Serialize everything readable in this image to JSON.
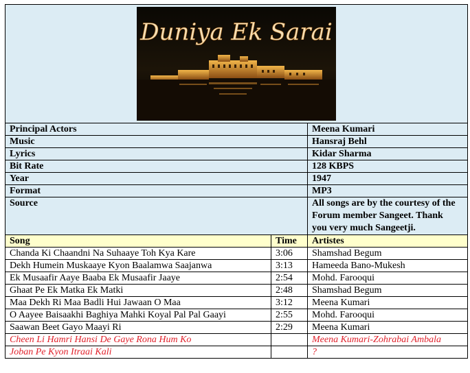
{
  "banner": {
    "title": "Duniya Ek Sarai"
  },
  "info": [
    {
      "label": "Principal Actors",
      "value": "Meena Kumari"
    },
    {
      "label": "Music",
      "value": "Hansraj Behl"
    },
    {
      "label": "Lyrics",
      "value": "Kidar Sharma"
    },
    {
      "label": "Bit Rate",
      "value": "128 KBPS"
    },
    {
      "label": "Year",
      "value": "1947"
    },
    {
      "label": "Format",
      "value": "MP3"
    },
    {
      "label": "Source",
      "value": "All songs are by the courtesy of the Forum member Sangeet.  Thank you very much Sangeetji."
    }
  ],
  "songs_header": {
    "song": "Song",
    "time": "Time",
    "artists": "Artistes"
  },
  "songs": [
    {
      "song": "Chanda Ki Chaandni Na Suhaaye Toh Kya Kare",
      "time": "3:06",
      "artists": "Shamshad Begum"
    },
    {
      "song": "Dekh Humein Muskaaye Kyon Baalamwa Saajanwa",
      "time": "3:13",
      "artists": "Hameeda Bano-Mukesh"
    },
    {
      "song": "Ek Musaafir Aaye Baaba Ek Musaafir Jaaye",
      "time": "2:54",
      "artists": "Mohd. Farooqui"
    },
    {
      "song": "Ghaat Pe Ek Matka Ek Matki",
      "time": "2:48",
      "artists": "Shamshad Begum"
    },
    {
      "song": "Maa Dekh Ri Maa Badli Hui Jawaan O Maa",
      "time": "3:12",
      "artists": "Meena Kumari"
    },
    {
      "song": "O Aayee Baisaakhi  Baghiya Mahki Koyal Pal Pal Gaayi",
      "time": "2:55",
      "artists": "Mohd. Farooqui"
    },
    {
      "song": "Saawan Beet Gayo Maayi Ri",
      "time": "2:29",
      "artists": "Meena Kumari"
    }
  ],
  "missing_songs": [
    {
      "song": "Cheen Li Hamri Hansi De Gaye Rona Hum Ko",
      "time": "",
      "artists": "Meena Kumari-Zohrabai Ambala"
    },
    {
      "song": "Joban Pe Kyon Itraai Kali",
      "time": "",
      "artists": "?"
    }
  ],
  "colors": {
    "info_bg": "#dcecf4",
    "header_bg": "#ffffcc",
    "missing_text": "#e0202a"
  }
}
